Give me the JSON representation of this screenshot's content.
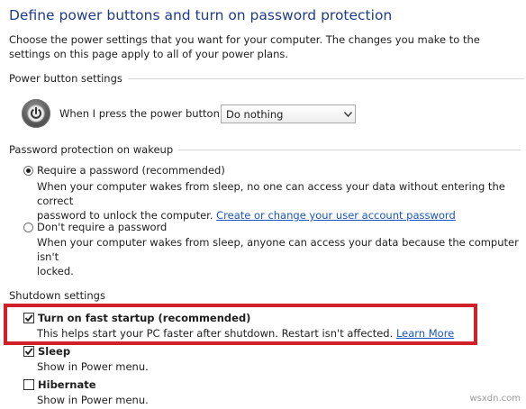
{
  "page": {
    "title": "Define power buttons and turn on password protection",
    "intro": "Choose the power settings that you want for your computer. The changes you make to the settings on this page apply to all of your power plans."
  },
  "power_button": {
    "header": "Power button settings",
    "label": "When I press the power button:",
    "selected": "Do nothing"
  },
  "password": {
    "header": "Password protection on wakeup",
    "require": {
      "label": "Require a password (recommended)",
      "selected": true,
      "desc_line1": "When your computer wakes from sleep, no one can access your data without entering the correct",
      "desc_line2": "password to unlock the computer.",
      "link": "Create or change your user account password"
    },
    "no_require": {
      "label": "Don't require a password",
      "selected": false,
      "desc_line1": "When your computer wakes from sleep, anyone can access your data because the computer isn't",
      "desc_line2": "locked."
    }
  },
  "shutdown": {
    "header": "Shutdown settings",
    "fast_startup": {
      "label": "Turn on fast startup (recommended)",
      "checked": true,
      "desc": "This helps start your PC faster after shutdown. Restart isn't affected.",
      "link": "Learn More"
    },
    "sleep": {
      "label": "Sleep",
      "checked": true,
      "desc": "Show in Power menu."
    },
    "hibernate": {
      "label": "Hibernate",
      "checked": false,
      "desc": "Show in Power menu."
    }
  },
  "watermark": "wsxdn.com",
  "colors": {
    "title": "#1f3c88",
    "link": "#1a56c4",
    "highlight": "#d0202a"
  }
}
